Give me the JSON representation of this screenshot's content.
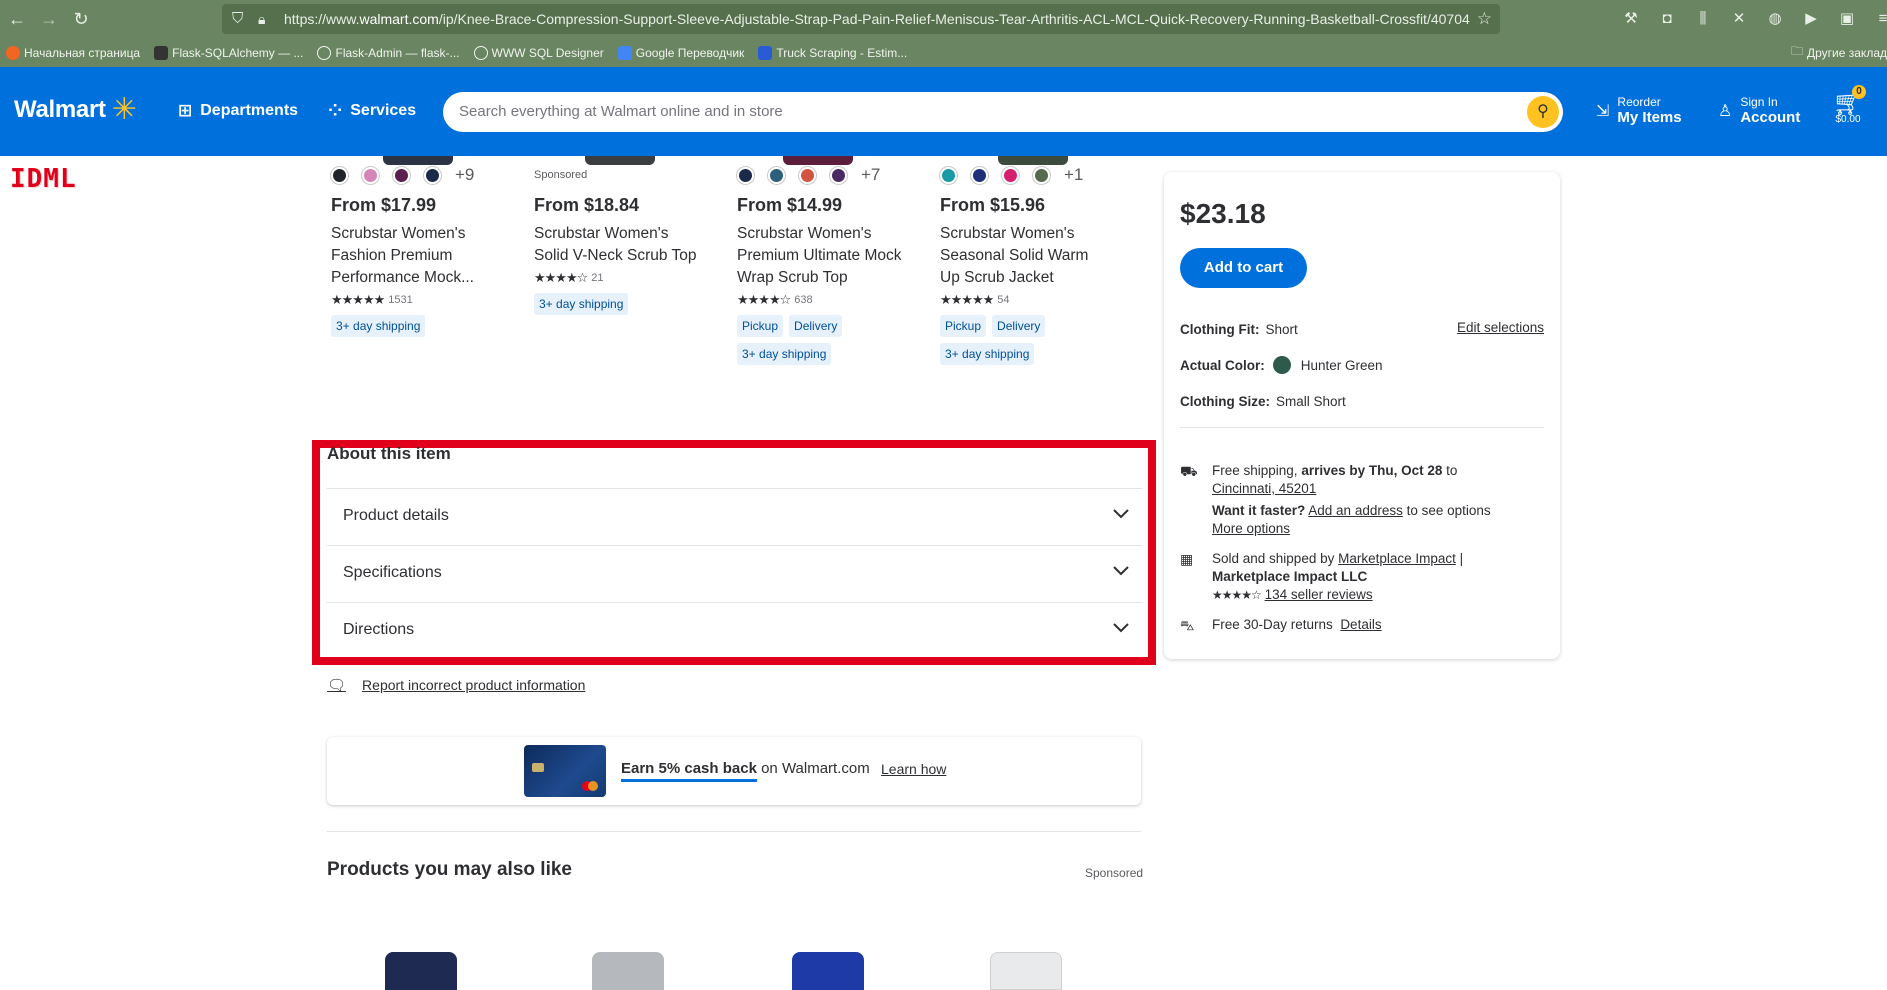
{
  "browser": {
    "url_prefix": "https://www.",
    "url_host": "walmart.com",
    "url_path": "/ip/Knee-Brace-Compression-Support-Sleeve-Adjustable-Strap-Pad-Pain-Relief-Meniscus-Tear-Arthritis-ACL-MCL-Quick-Recovery-Running-Basketball-Crossfit/40704",
    "bookmarks": [
      "Начальная страница",
      "Flask-SQLAlchemy — ...",
      "Flask-Admin — flask-...",
      "WWW SQL Designer",
      "Google Переводчик",
      "Truck Scraping - Estim..."
    ],
    "other_bookmarks": "Другие заклад"
  },
  "header": {
    "logo_text": "Walmart",
    "departments": "Departments",
    "services": "Services",
    "search_placeholder": "Search everything at Walmart online and in store",
    "reorder_small": "Reorder",
    "reorder_big": "My Items",
    "signin_small": "Sign In",
    "signin_big": "Account",
    "cart_count": "0",
    "cart_amount": "$0.00"
  },
  "watermark": "IDML",
  "carousel": [
    {
      "price": "From $17.99",
      "name": "Scrubstar Women's Fashion Premium Performance Mock...",
      "stars": "★★★★★",
      "reviews": "1531",
      "more_colors": "+9",
      "sponsored": "",
      "tags": [
        "3+ day shipping"
      ]
    },
    {
      "price": "From $18.84",
      "name": "Scrubstar Women's Solid V-Neck Scrub Top",
      "stars": "★★★★☆",
      "reviews": "21",
      "more_colors": "",
      "sponsored": "Sponsored",
      "tags": [
        "3+ day shipping"
      ]
    },
    {
      "price": "From $14.99",
      "name": "Scrubstar Women's Premium Ultimate Mock Wrap Scrub Top",
      "stars": "★★★★☆",
      "reviews": "638",
      "more_colors": "+7",
      "sponsored": "",
      "tags": [
        "Pickup",
        "Delivery",
        "3+ day shipping"
      ]
    },
    {
      "price": "From $15.96",
      "name": "Scrubstar Women's Seasonal Solid Warm Up Scrub Jacket",
      "stars": "★★★★★",
      "reviews": "54",
      "more_colors": "+1",
      "sponsored": "",
      "tags": [
        "Pickup",
        "Delivery",
        "3+ day shipping"
      ]
    }
  ],
  "about": {
    "title": "About this item",
    "rows": [
      "Product details",
      "Specifications",
      "Directions"
    ],
    "report": "Report incorrect product information"
  },
  "promo": {
    "earn": "Earn 5% cash back",
    "on": " on Walmart.com",
    "learn": "Learn how"
  },
  "also": {
    "title": "Products you may also like",
    "sponsored": "Sponsored"
  },
  "buybox": {
    "price": "$23.18",
    "add_to_cart": "Add to cart",
    "fit_label": "Clothing Fit:",
    "fit_value": "Short",
    "edit": "Edit selections",
    "color_label": "Actual Color:",
    "color_value": "Hunter Green",
    "size_label": "Clothing Size:",
    "size_value": "Small Short",
    "ship_free": "Free shipping, ",
    "ship_arrives": "arrives by Thu, Oct 28",
    "ship_to": " to",
    "ship_location": "Cincinnati, 45201",
    "faster_q": "Want it faster?",
    "add_address": "Add an address",
    "see_options": " to see options",
    "more_options": "More options",
    "sold_by_prefix": "Sold and shipped by ",
    "seller": "Marketplace Impact",
    "seller_sep": " |",
    "seller_llc": "Marketplace Impact LLC",
    "seller_reviews": "134 seller reviews",
    "returns": "Free 30-Day returns",
    "details": "Details"
  },
  "colors": {
    "brand_blue": "#0071dc",
    "spark_yellow": "#ffc220",
    "highlight_red": "#e0001b",
    "selected_color": "#2d5a4a"
  }
}
